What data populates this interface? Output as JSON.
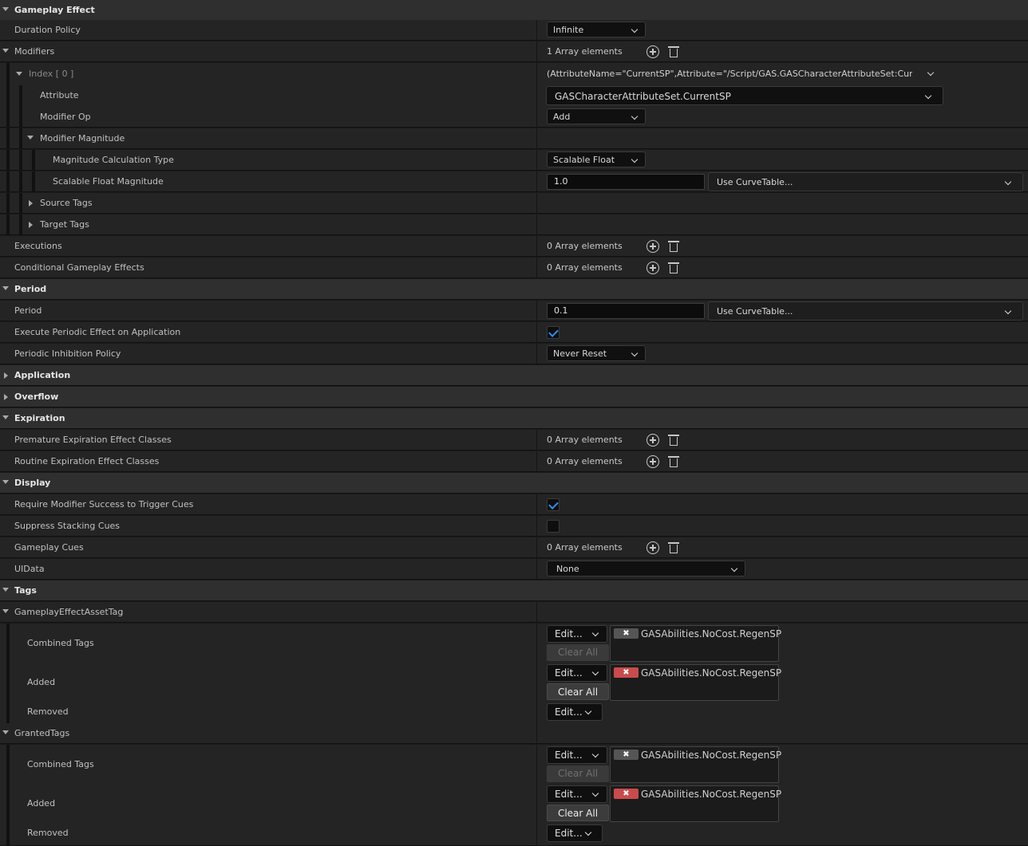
{
  "gameplay_effect": {
    "category": "Gameplay Effect",
    "duration_policy": {
      "label": "Duration Policy",
      "value": "Infinite"
    },
    "modifiers": {
      "label": "Modifiers",
      "count": "1 Array elements",
      "index_label": "Index [ 0 ]",
      "index_value": "(AttributeName=\"CurrentSP\",Attribute=\"/Script/GAS.GASCharacterAttributeSet:CurrentSP\",A",
      "attribute": {
        "label": "Attribute",
        "value": "GASCharacterAttributeSet.CurrentSP"
      },
      "modifier_op": {
        "label": "Modifier Op",
        "value": "Add"
      },
      "modifier_magnitude": "Modifier Magnitude",
      "calc_type": {
        "label": "Magnitude Calculation Type",
        "value": "Scalable Float"
      },
      "scalable_float": {
        "label": "Scalable Float Magnitude",
        "value": "1.0",
        "curve": "Use CurveTable..."
      },
      "source_tags": "Source Tags",
      "target_tags": "Target Tags"
    },
    "executions": {
      "label": "Executions",
      "count": "0 Array elements"
    },
    "conditional": {
      "label": "Conditional Gameplay Effects",
      "count": "0 Array elements"
    }
  },
  "period": {
    "category": "Period",
    "period": {
      "label": "Period",
      "value": "0.1",
      "curve": "Use CurveTable..."
    },
    "execute_on_application": {
      "label": "Execute Periodic Effect on Application",
      "checked": true
    },
    "inhibition": {
      "label": "Periodic Inhibition Policy",
      "value": "Never Reset"
    }
  },
  "application": {
    "category": "Application"
  },
  "overflow": {
    "category": "Overflow"
  },
  "expiration": {
    "category": "Expiration",
    "premature": {
      "label": "Premature Expiration Effect Classes",
      "count": "0 Array elements"
    },
    "routine": {
      "label": "Routine Expiration Effect Classes",
      "count": "0 Array elements"
    }
  },
  "display": {
    "category": "Display",
    "require_success": {
      "label": "Require Modifier Success to Trigger Cues",
      "checked": true
    },
    "suppress_stacking": {
      "label": "Suppress Stacking Cues",
      "checked": false
    },
    "gameplay_cues": {
      "label": "Gameplay Cues",
      "count": "0 Array elements"
    },
    "uidata": {
      "label": "UIData",
      "value": "None"
    }
  },
  "tags": {
    "category": "Tags",
    "asset_tag": {
      "label": "GameplayEffectAssetTag",
      "combined": {
        "label": "Combined Tags",
        "edit": "Edit...",
        "clear": "Clear All",
        "tag": "GASAbilities.NoCost.RegenSP"
      },
      "added": {
        "label": "Added",
        "edit": "Edit...",
        "clear": "Clear All",
        "tag": "GASAbilities.NoCost.RegenSP"
      },
      "removed": {
        "label": "Removed",
        "edit": "Edit..."
      }
    },
    "granted_tags": {
      "label": "GrantedTags",
      "combined": {
        "label": "Combined Tags",
        "edit": "Edit...",
        "clear": "Clear All",
        "tag": "GASAbilities.NoCost.RegenSP"
      },
      "added": {
        "label": "Added",
        "edit": "Edit...",
        "clear": "Clear All",
        "tag": "GASAbilities.NoCost.RegenSP"
      },
      "removed": {
        "label": "Removed",
        "edit": "Edit..."
      }
    }
  },
  "glyphs": {
    "remove_tag": "✖"
  },
  "colors": {
    "check": "#2f8ef0",
    "tag_remove_active": "#c94b4b",
    "tag_remove_inactive": "#555555"
  }
}
